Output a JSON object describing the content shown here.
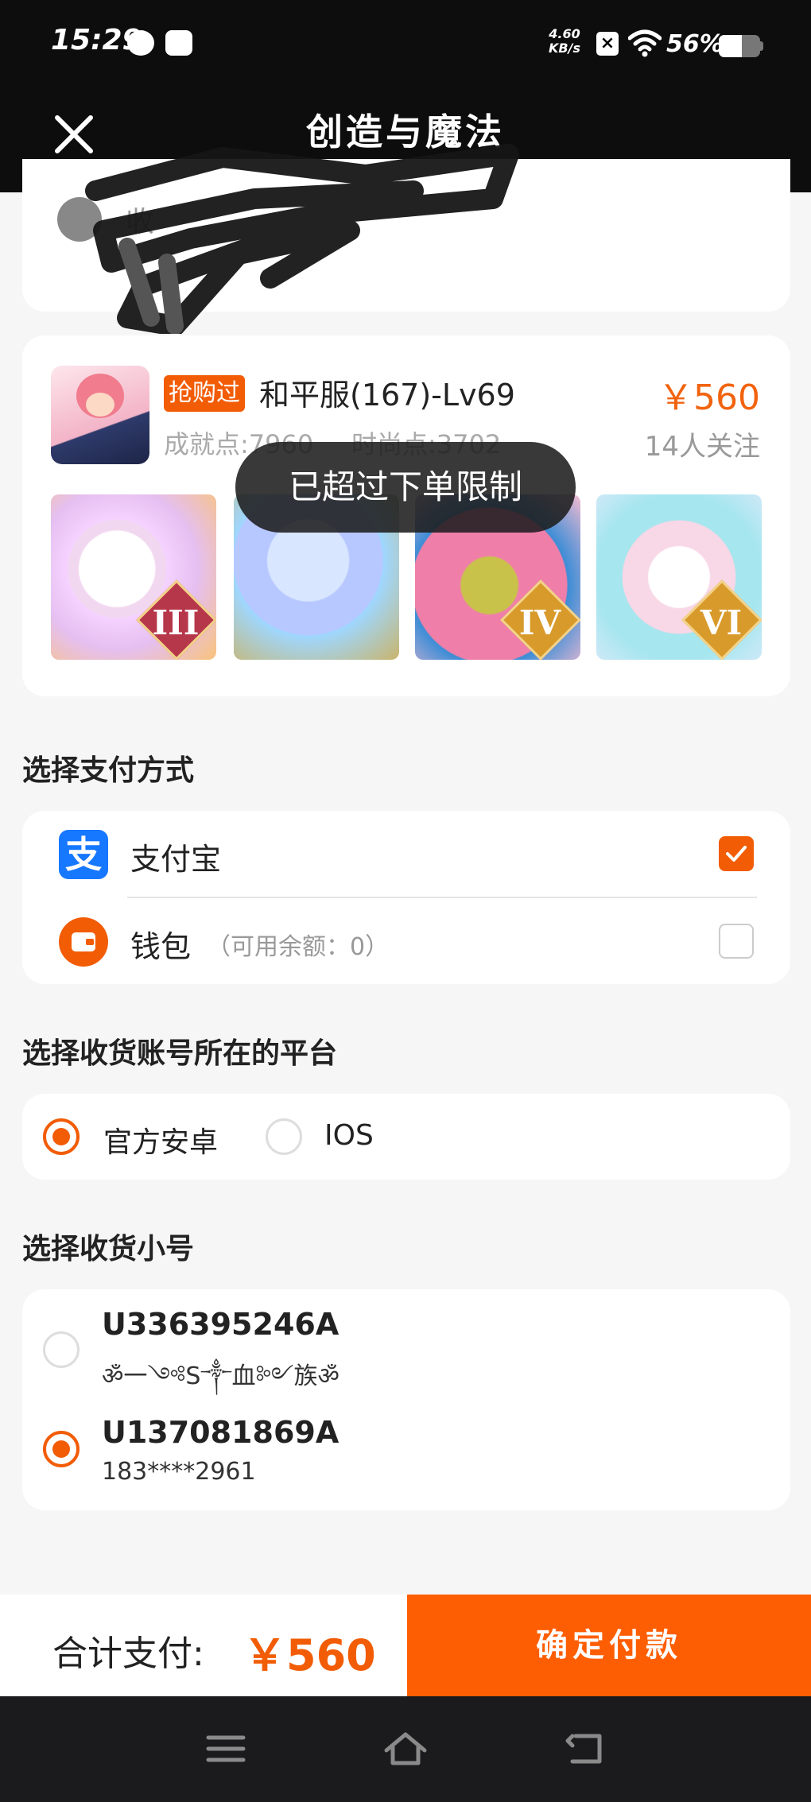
{
  "status_bar": {
    "time": "15:29",
    "net_speed_value": "4.60",
    "net_speed_unit": "KB/s",
    "battery_text": "56%",
    "battery_level": 0.56,
    "icons": [
      "notification-icon",
      "tiktok-icon",
      "no-sim-icon",
      "wifi-icon",
      "battery-icon"
    ]
  },
  "header": {
    "title": "创造与魔法",
    "close_icon": "close-icon"
  },
  "top_card": {
    "visible_text": "收"
  },
  "product": {
    "tag": "抢购过",
    "name": "和平服(167)-Lv69",
    "price": "￥560",
    "achievement": "成就点:7960",
    "fashion": "时尚点:3702",
    "followers": "14人关注",
    "thumbnails": [
      {
        "badge": "III"
      },
      {
        "badge": ""
      },
      {
        "badge": "IV"
      },
      {
        "badge": "VI"
      }
    ]
  },
  "toast": "已超过下单限制",
  "payment": {
    "title": "选择支付方式",
    "options": [
      {
        "label": "支付宝",
        "note": "",
        "checked": true,
        "icon": "alipay-icon"
      },
      {
        "label": "钱包",
        "note": "（可用余额：0）",
        "checked": false,
        "icon": "wallet-icon"
      }
    ]
  },
  "platform": {
    "title": "选择收货账号所在的平台",
    "options": [
      {
        "label": "官方安卓",
        "selected": true
      },
      {
        "label": "IOS",
        "selected": false
      }
    ]
  },
  "accounts": {
    "title": "选择收货小号",
    "items": [
      {
        "id": "U336395246A",
        "sub": "ॐ一༺S༒血༻族ॐ",
        "selected": false
      },
      {
        "id": "U137081869A",
        "sub": "183****2961",
        "selected": true
      }
    ]
  },
  "footer": {
    "total_label": "合计支付:",
    "total_value": "￥560",
    "confirm": "确定付款"
  },
  "colors": {
    "accent": "#F25C05",
    "header_bg": "#0D0D0D",
    "alipay": "#1677FF"
  }
}
